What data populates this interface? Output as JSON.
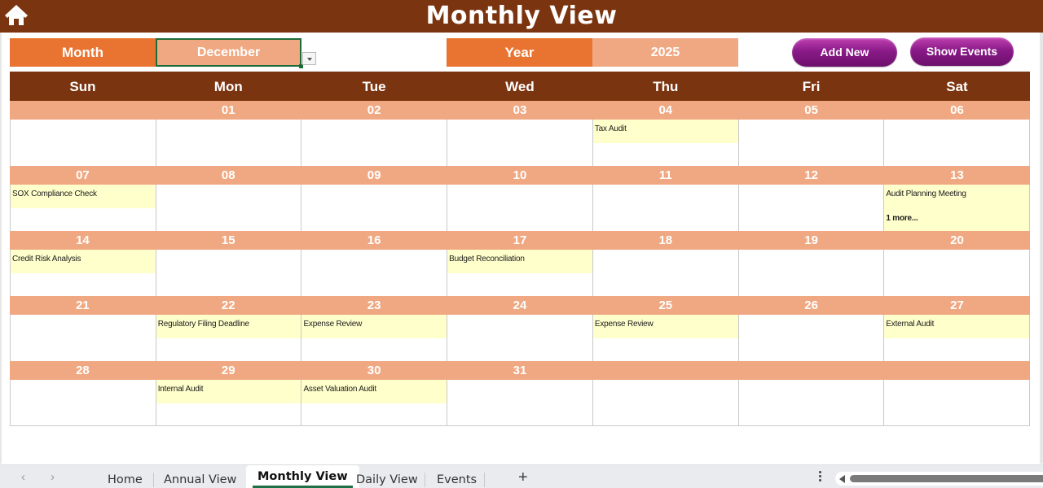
{
  "header": {
    "title": "Monthly View",
    "home_icon": "home-icon"
  },
  "controls": {
    "month_label": "Month",
    "month_value": "December",
    "year_label": "Year",
    "year_value": "2025",
    "add_new_label": "Add New",
    "show_events_label": "Show Events"
  },
  "colors": {
    "header_brown": "#7b3410",
    "label_orange": "#e97432",
    "value_peach": "#f0a882",
    "event_yellow": "#ffffcc",
    "button_purple": "#8a1a88",
    "active_tab_green": "#1e7145"
  },
  "calendar": {
    "weekdays": [
      "Sun",
      "Mon",
      "Tue",
      "Wed",
      "Thu",
      "Fri",
      "Sat"
    ],
    "weeks": [
      {
        "dates": [
          "",
          "01",
          "02",
          "03",
          "04",
          "05",
          "06"
        ],
        "events": [
          "",
          "",
          "",
          "",
          "Tax Audit",
          "",
          ""
        ],
        "more": [
          "",
          "",
          "",
          "",
          "",
          "",
          ""
        ]
      },
      {
        "dates": [
          "07",
          "08",
          "09",
          "10",
          "11",
          "12",
          "13"
        ],
        "events": [
          "SOX Compliance Check",
          "",
          "",
          "",
          "",
          "",
          "Audit Planning Meeting"
        ],
        "more": [
          "",
          "",
          "",
          "",
          "",
          "",
          "1 more..."
        ]
      },
      {
        "dates": [
          "14",
          "15",
          "16",
          "17",
          "18",
          "19",
          "20"
        ],
        "events": [
          "Credit Risk Analysis",
          "",
          "",
          "Budget Reconciliation",
          "",
          "",
          ""
        ],
        "more": [
          "",
          "",
          "",
          "",
          "",
          "",
          ""
        ]
      },
      {
        "dates": [
          "21",
          "22",
          "23",
          "24",
          "25",
          "26",
          "27"
        ],
        "events": [
          "",
          "Regulatory Filing Deadline",
          "Expense Review",
          "",
          "Expense Review",
          "",
          "External Audit"
        ],
        "more": [
          "",
          "",
          "",
          "",
          "",
          "",
          ""
        ]
      },
      {
        "dates": [
          "28",
          "29",
          "30",
          "31",
          "",
          "",
          ""
        ],
        "events": [
          "",
          "Internal Audit",
          "Asset Valuation Audit",
          "",
          "",
          "",
          ""
        ],
        "more": [
          "",
          "",
          "",
          "",
          "",
          "",
          ""
        ]
      }
    ]
  },
  "sheet_tabs": {
    "prev_icon": "‹",
    "next_icon": "›",
    "tabs": [
      "Home",
      "Annual View",
      "Monthly View",
      "Daily View",
      "Events"
    ],
    "active": "Monthly View",
    "add_icon": "+"
  }
}
